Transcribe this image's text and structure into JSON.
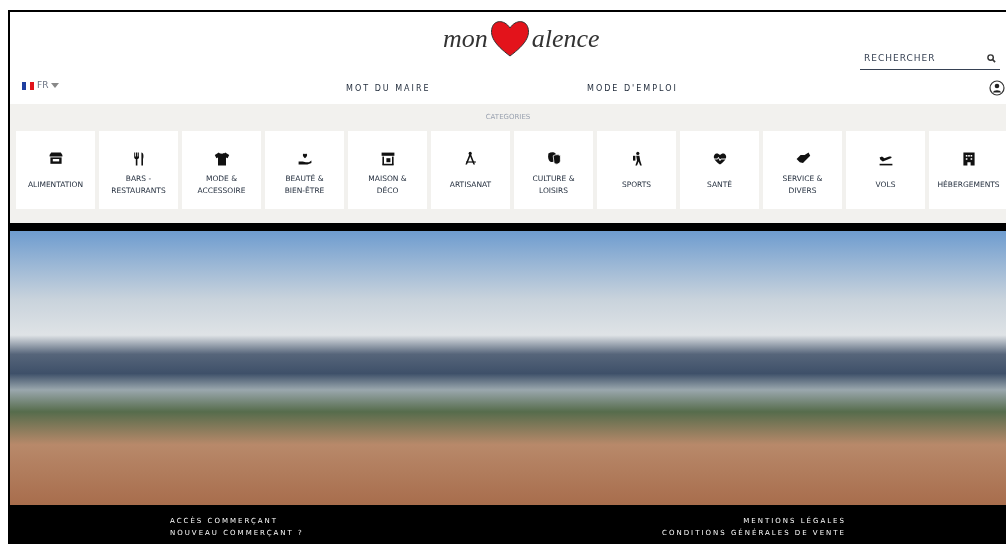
{
  "header": {
    "logo": {
      "part_1": "mon",
      "part_2": "alence"
    },
    "language": "FR",
    "search": {
      "placeholder": "RECHERCHER"
    },
    "nav": [
      "MOT DU MAIRE",
      "MODE D'EMPLOI"
    ]
  },
  "categories": {
    "title": "CATEGORIES",
    "items": [
      {
        "label": "ALIMENTATION"
      },
      {
        "label": "BARS -\nRESTAURANTS"
      },
      {
        "label": "MODE &\nACCESSOIRE"
      },
      {
        "label": "BEAUTÉ &\nBIEN-ÊTRE"
      },
      {
        "label": "MAISON &\nDÉCO"
      },
      {
        "label": "ARTISANAT"
      },
      {
        "label": "CULTURE &\nLOISIRS"
      },
      {
        "label": "SPORTS"
      },
      {
        "label": "SANTÉ"
      },
      {
        "label": "SERVICE &\nDIVERS"
      },
      {
        "label": "VOLS"
      },
      {
        "label": "HÉBERGEMENTS"
      }
    ]
  },
  "footer": {
    "left": [
      "ACCÈS COMMERÇANT",
      "NOUVEAU COMMERÇANT ?"
    ],
    "right": [
      "MENTIONS LÉGALES",
      "CONDITIONS GÉNÉRALES DE VENTE"
    ]
  }
}
